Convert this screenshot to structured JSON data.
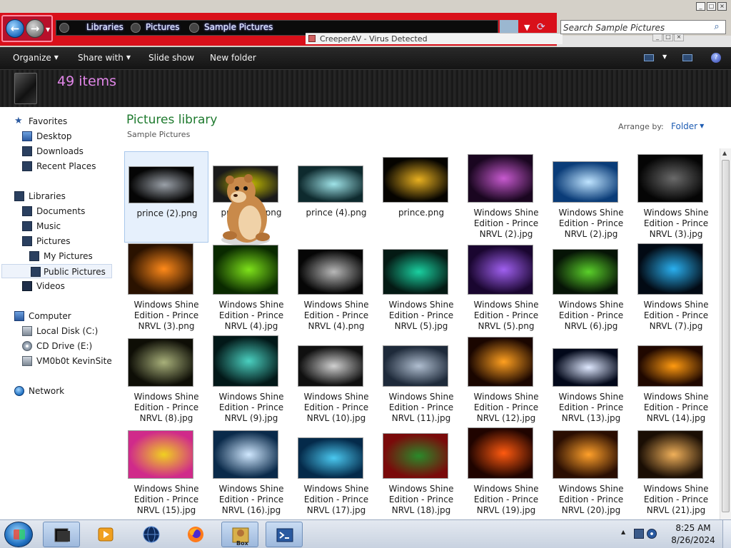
{
  "window": {
    "breadcrumbs": [
      "Libraries",
      "Pictures",
      "Sample Pictures"
    ],
    "search_placeholder": "Search Sample Pictures",
    "popup_title": "CreeperAV - Virus Detected"
  },
  "toolbar": {
    "organize": "Organize",
    "share_with": "Share with",
    "slide_show": "Slide show",
    "new_folder": "New folder"
  },
  "details": {
    "item_count": "49 items"
  },
  "nav": {
    "favorites": "Favorites",
    "desktop": "Desktop",
    "downloads": "Downloads",
    "recent_places": "Recent Places",
    "libraries": "Libraries",
    "documents": "Documents",
    "music": "Music",
    "pictures": "Pictures",
    "my_pictures": "My Pictures",
    "public_pictures": "Public Pictures",
    "videos": "Videos",
    "computer": "Computer",
    "local_disk": "Local Disk (C:)",
    "cd_drive": "CD Drive (E:)",
    "vm_share": "VM0b0t KevinSite",
    "network": "Network"
  },
  "content": {
    "title": "Pictures library",
    "subtitle": "Sample Pictures",
    "arrange_label": "Arrange by:",
    "arrange_value": "Folder"
  },
  "files": [
    {
      "name": "prince (2).png",
      "colors": [
        "#050505",
        "#9aa0a8"
      ],
      "selected": true
    },
    {
      "name": "prince (3).png",
      "colors": [
        "#1a1a1a",
        "#c8c000"
      ]
    },
    {
      "name": "prince (4).png",
      "colors": [
        "#0e2a2e",
        "#9fe3e8"
      ]
    },
    {
      "name": "prince.png",
      "colors": [
        "#060400",
        "#e8b020"
      ]
    },
    {
      "name": "Windows Shine Edition - Prince NRVL (2).jpg",
      "colors": [
        "#1a0620",
        "#c85ad0"
      ]
    },
    {
      "name": "Windows Shine Edition - Prince NRVL (2).jpg",
      "colors": [
        "#0a3c78",
        "#bfe4ff"
      ]
    },
    {
      "name": "Windows Shine Edition - Prince NRVL (3).jpg",
      "colors": [
        "#050505",
        "#6a6a6a"
      ]
    },
    {
      "name": "Windows Shine Edition - Prince NRVL (3).png",
      "colors": [
        "#2a1200",
        "#ff8a1a"
      ]
    },
    {
      "name": "Windows Shine Edition - Prince NRVL (4).jpg",
      "colors": [
        "#0a2a00",
        "#7ee21a"
      ]
    },
    {
      "name": "Windows Shine Edition - Prince NRVL (4).png",
      "colors": [
        "#060606",
        "#b8b8b8"
      ]
    },
    {
      "name": "Windows Shine Edition - Prince NRVL (5).jpg",
      "colors": [
        "#041a14",
        "#1ad0a0"
      ]
    },
    {
      "name": "Windows Shine Edition - Prince NRVL (5).png",
      "colors": [
        "#1a0630",
        "#a060f0"
      ]
    },
    {
      "name": "Windows Shine Edition - Prince NRVL (6).jpg",
      "colors": [
        "#061406",
        "#5ad02a"
      ]
    },
    {
      "name": "Windows Shine Edition - Prince NRVL (7).jpg",
      "colors": [
        "#020a14",
        "#2ab0f0"
      ]
    },
    {
      "name": "Windows Shine Edition - Prince NRVL (8).jpg",
      "colors": [
        "#0e0e06",
        "#a8b07a"
      ]
    },
    {
      "name": "Windows Shine Edition - Prince NRVL (9).jpg",
      "colors": [
        "#021818",
        "#4ad0c0"
      ]
    },
    {
      "name": "Windows Shine Edition - Prince NRVL (10).jpg",
      "colors": [
        "#101010",
        "#d0d0d0"
      ]
    },
    {
      "name": "Windows Shine Edition - Prince NRVL (11).jpg",
      "colors": [
        "#1e2a3a",
        "#b0bed0"
      ]
    },
    {
      "name": "Windows Shine Edition - Prince NRVL (12).jpg",
      "colors": [
        "#1a0600",
        "#ffa020"
      ]
    },
    {
      "name": "Windows Shine Edition - Prince NRVL (13).jpg",
      "colors": [
        "#02081a",
        "#dfe8ff"
      ]
    },
    {
      "name": "Windows Shine Edition - Prince NRVL (14).jpg",
      "colors": [
        "#200800",
        "#ff9a10"
      ]
    },
    {
      "name": "Windows Shine Edition - Prince NRVL (15).jpg",
      "colors": [
        "#d02a8a",
        "#f0d020"
      ]
    },
    {
      "name": "Windows Shine Edition - Prince NRVL (16).jpg",
      "colors": [
        "#0a2a4a",
        "#d0e8ff"
      ]
    },
    {
      "name": "Windows Shine Edition - Prince NRVL (17).jpg",
      "colors": [
        "#042a4a",
        "#4ac8f0"
      ]
    },
    {
      "name": "Windows Shine Edition - Prince NRVL (18).jpg",
      "colors": [
        "#7a0a0a",
        "#2a8a2a"
      ]
    },
    {
      "name": "Windows Shine Edition - Prince NRVL (19).jpg",
      "colors": [
        "#200400",
        "#ff5a10"
      ]
    },
    {
      "name": "Windows Shine Edition - Prince NRVL (20).jpg",
      "colors": [
        "#2a0e02",
        "#ffa02a"
      ]
    },
    {
      "name": "Windows Shine Edition - Prince NRVL (21).jpg",
      "colors": [
        "#1a0e04",
        "#f0b05a"
      ]
    }
  ],
  "taskbar": {
    "time": "8:25 AM",
    "date": "8/26/2024",
    "apps": [
      "explorer-icon",
      "media-player-icon",
      "globe-icon",
      "firefox-icon",
      "bonzi-box-icon",
      "powershell-icon"
    ],
    "box_label": "Box"
  },
  "colors": {
    "accent_green": "#1e7a2e",
    "item_count_pink": "#e186e8",
    "link_blue": "#1e5cb3",
    "titlebar_red": "#d9101a"
  }
}
